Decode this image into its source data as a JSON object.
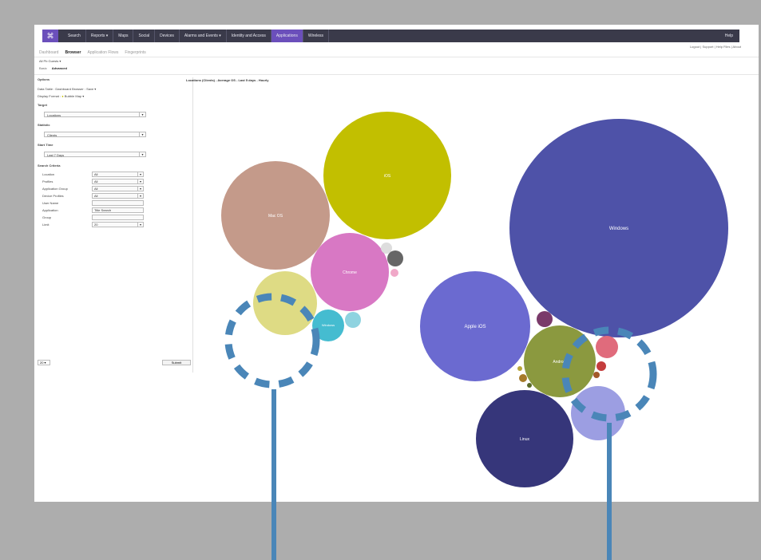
{
  "nav": {
    "items": [
      "Search",
      "Reports ▾",
      "Maps",
      "Social",
      "Devices",
      "Alarms and Events ▾",
      "Identity and Access",
      "Applications",
      "Wireless"
    ],
    "active_index": 7,
    "help": "Help"
  },
  "top_links": "Logout | Support | Help Files | About",
  "subtabs": {
    "items": [
      "Dashboard",
      "Browser",
      "Application Flows",
      "Fingerprints"
    ],
    "active_index": 1
  },
  "breadcrumb": "All Pb Guests ▾",
  "modes": {
    "basic": "Basic",
    "advanced": "Advanced"
  },
  "options": {
    "title": "Options",
    "data_table": "Data Table : Dashboard Browser : Save ▾",
    "display_format": "Display Format :",
    "display_format_value": "Bubble Map ▾",
    "target_label": "Target",
    "target_value": "Locations",
    "statistic_label": "Statistic",
    "statistic_value": "Clients",
    "start_time_label": "Start Time",
    "start_time_value": "Last 7 Days",
    "criteria_label": "Search Criteria",
    "criteria": [
      {
        "label": "Location",
        "value": "All"
      },
      {
        "label": "Profiles",
        "value": "All"
      },
      {
        "label": "Application Group",
        "value": "All"
      },
      {
        "label": "Device Profiles",
        "value": "All"
      },
      {
        "label": "User Name",
        "value": ""
      },
      {
        "label": "Application",
        "value": "Title Search"
      },
      {
        "label": "Group",
        "value": ""
      },
      {
        "label": "Limit",
        "value": "20"
      }
    ],
    "page_size": "20 ▾",
    "submit": "Submit"
  },
  "chart_header": "Locations (Clients) - Average OS - Last 5 days - Hourly",
  "chart_data": {
    "type": "bubble",
    "bubbles": [
      {
        "label": "Windows",
        "color": "#4e52a8"
      },
      {
        "label": "iOS",
        "color": "#c2bf00"
      },
      {
        "label": "Mac OS",
        "color": "#c49a8a"
      },
      {
        "label": "Chrome",
        "color": "#d878c4"
      },
      {
        "label": "Apple iOS",
        "color": "#6b6ad0"
      },
      {
        "label": "Android",
        "color": "#8b993f"
      },
      {
        "label": "Linux",
        "color": "#36367a"
      },
      {
        "label": "Windows",
        "color": "#45bcd0"
      }
    ]
  },
  "annotations": {
    "color": "#4a86b8"
  }
}
